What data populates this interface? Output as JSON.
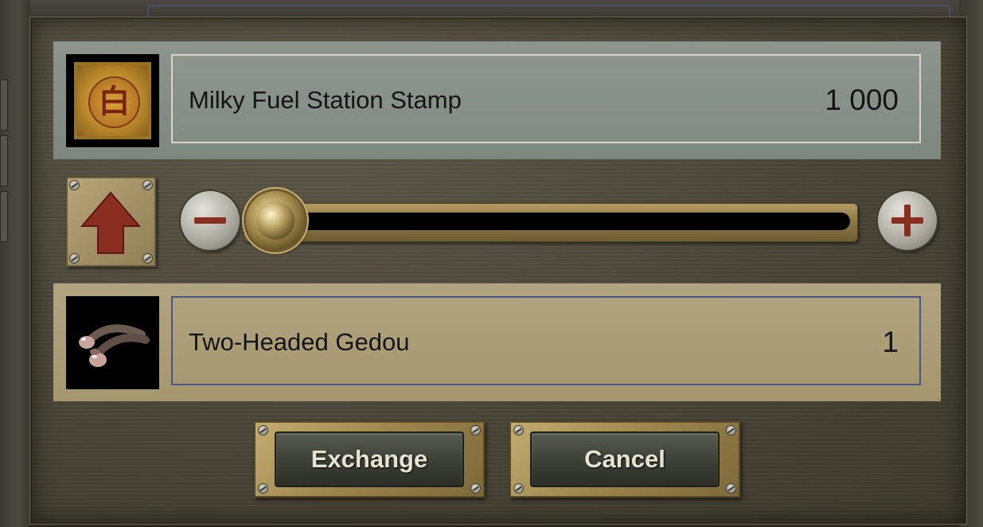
{
  "exchange_dialog": {
    "source_item": {
      "name": "Milky Fuel Station Stamp",
      "quantity": "1 000",
      "icon": "stamp-icon",
      "glyph": "白"
    },
    "target_item": {
      "name": "Two-Headed Gedou",
      "quantity": "1",
      "icon": "gedou-icon"
    },
    "slider": {
      "position_fraction": 0.0,
      "decrease_icon": "minus-icon",
      "increase_icon": "plus-icon",
      "direction_icon": "up-arrow-icon"
    },
    "buttons": {
      "exchange_label": "Exchange",
      "cancel_label": "Cancel"
    },
    "colors": {
      "source_row_bg": "#858c86",
      "target_row_bg": "#aa9d76",
      "target_border": "#4a5488",
      "arrow": "#8b2e22"
    }
  }
}
